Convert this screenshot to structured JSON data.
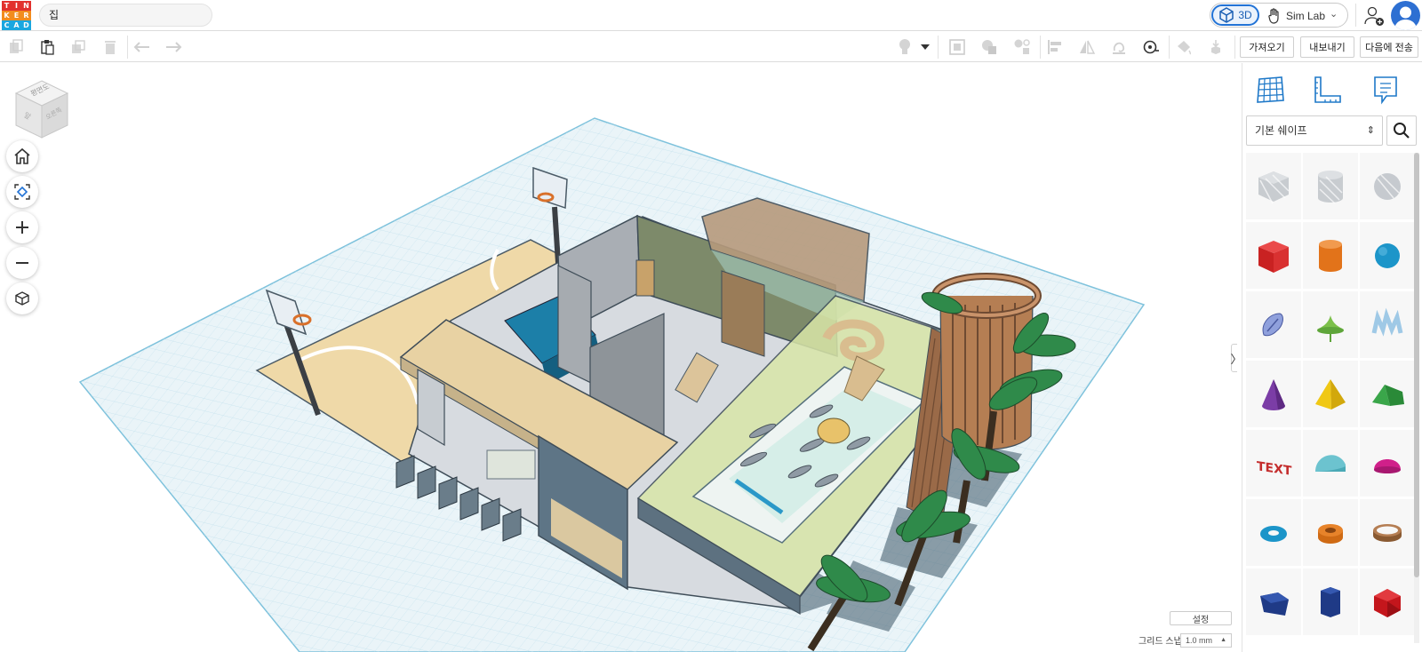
{
  "app": {
    "logo_letters": [
      "T",
      "I",
      "N",
      "K",
      "E",
      "R",
      "C",
      "A",
      "D"
    ],
    "logo_colors": [
      "#e2312e",
      "#e2312e",
      "#e2312e",
      "#f28c1e",
      "#f28c1e",
      "#f28c1e",
      "#1aa7e0",
      "#1aa7e0",
      "#1aa7e0"
    ],
    "project_title": "집"
  },
  "modes": {
    "three_d": "3D",
    "sim_lab": "Sim Lab"
  },
  "toolbar": {
    "import_label": "가져오기",
    "export_label": "내보내기",
    "send_to_label": "다음에 전송"
  },
  "viewcube": {
    "top_face": "평면도",
    "left_face": "앞",
    "right_face": "오른쪽"
  },
  "workplane": {
    "settings_label": "설정",
    "grid_snap_label": "그리드 스냅",
    "grid_snap_value": "1.0 mm"
  },
  "panel": {
    "shape_category": "기본 쉐이프",
    "shapes": [
      "box-hole-icon",
      "cylinder-hole-icon",
      "sphere-hole-icon",
      "box-icon",
      "cylinder-icon",
      "sphere-icon",
      "scribble-icon",
      "paraboloid-icon",
      "text-3d-icon",
      "cone-icon",
      "pyramid-icon",
      "roof-icon",
      "text-icon",
      "half-sphere-icon",
      "ellipsoid-icon",
      "torus-icon",
      "tube-icon",
      "ring-icon",
      "polygon-icon",
      "hexagonal-prism-icon",
      "icosahedron-icon"
    ]
  },
  "colors": {
    "accent": "#2273d6",
    "grid": "#8fc6dc",
    "workplane": "#e6f2f7"
  }
}
